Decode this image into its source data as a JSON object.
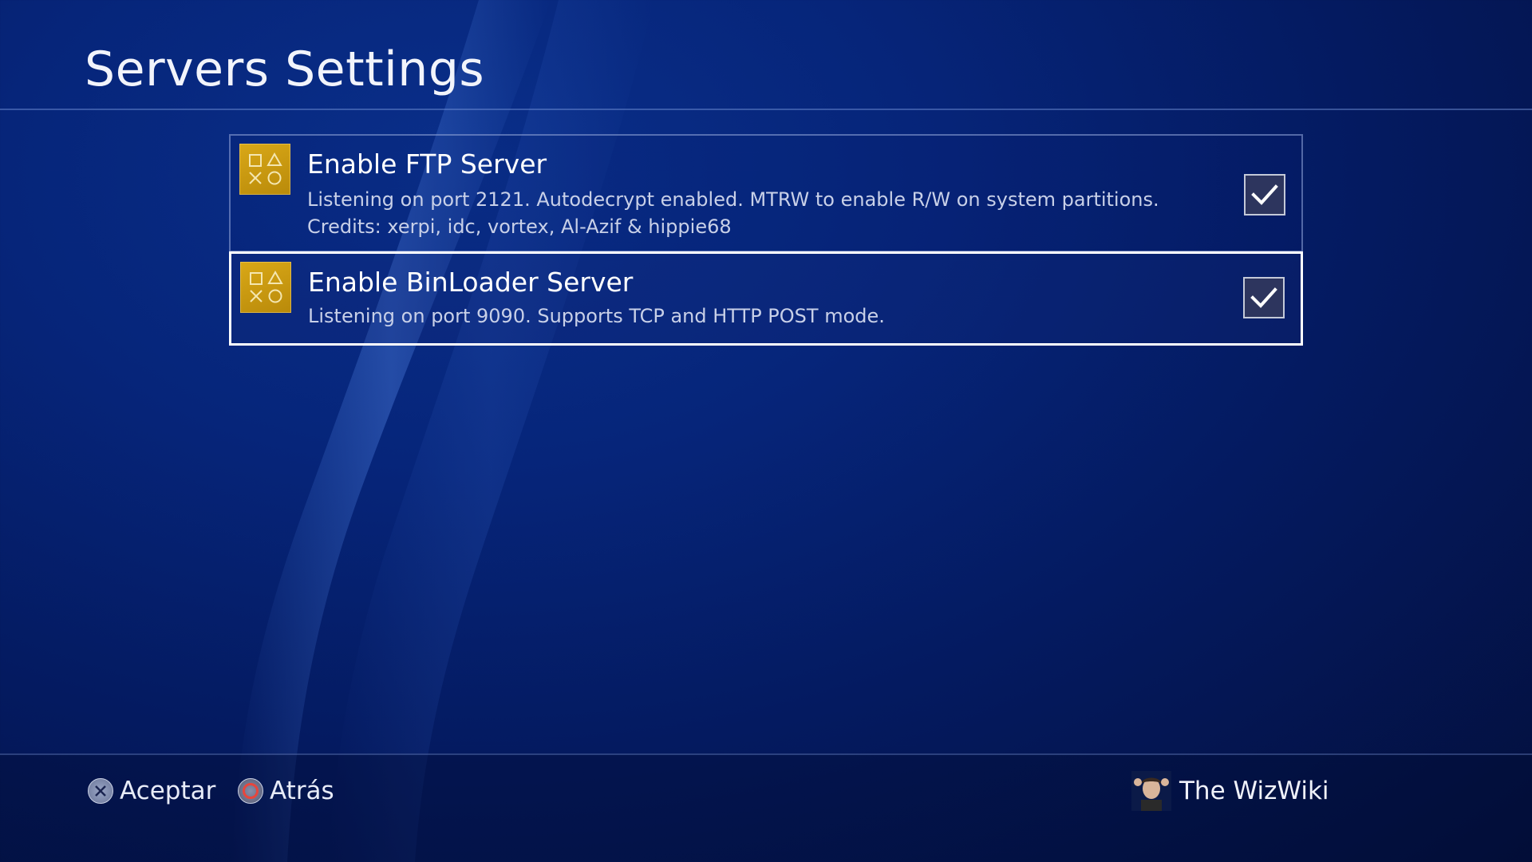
{
  "header": {
    "title": "Servers Settings"
  },
  "settings": [
    {
      "title": "Enable FTP Server",
      "desc_lines": [
        "Listening on port 2121. Autodecrypt enabled. MTRW to enable R/W on system partitions.",
        "Credits: xerpi, idc, vortex, Al-Azif & hippie68"
      ],
      "checked": true,
      "icon": "playstation-shapes-icon"
    },
    {
      "title": "Enable BinLoader Server",
      "desc_lines": [
        "Listening on port 9090. Supports TCP and HTTP POST mode."
      ],
      "checked": true,
      "focused": true,
      "icon": "playstation-shapes-icon"
    }
  ],
  "footer": {
    "accept_label": "Aceptar",
    "accept_icon": "cross-button-icon",
    "back_label": "Atrás",
    "back_icon": "circle-button-icon",
    "user_name": "The WizWiki"
  },
  "colors": {
    "background": "#041a60",
    "icon_gold": "#c99a10",
    "checkbox_fill": "#2d355e"
  }
}
